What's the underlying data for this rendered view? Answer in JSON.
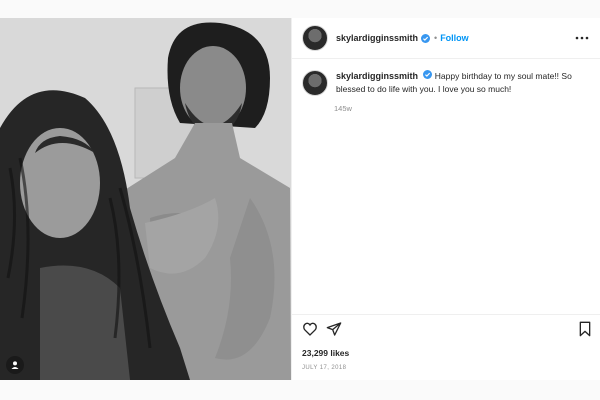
{
  "post": {
    "username": "skylardigginssmith",
    "follow_label": "Follow",
    "dot_separator": "•",
    "caption": "Happy birthday to my soul mate!! So blessed to do life with you. I love you so much!",
    "time_ago": "145w",
    "likes": "23,299 likes",
    "date": "JULY 17, 2018"
  },
  "icons": {
    "verified": "verified-badge-icon",
    "more": "more-options-icon",
    "heart": "heart-icon",
    "share": "share-icon",
    "bookmark": "bookmark-icon",
    "tag": "user-tag-icon"
  },
  "colors": {
    "accent": "#0095f6",
    "text": "#262626",
    "muted": "#8e8e8e",
    "border": "#efefef"
  }
}
